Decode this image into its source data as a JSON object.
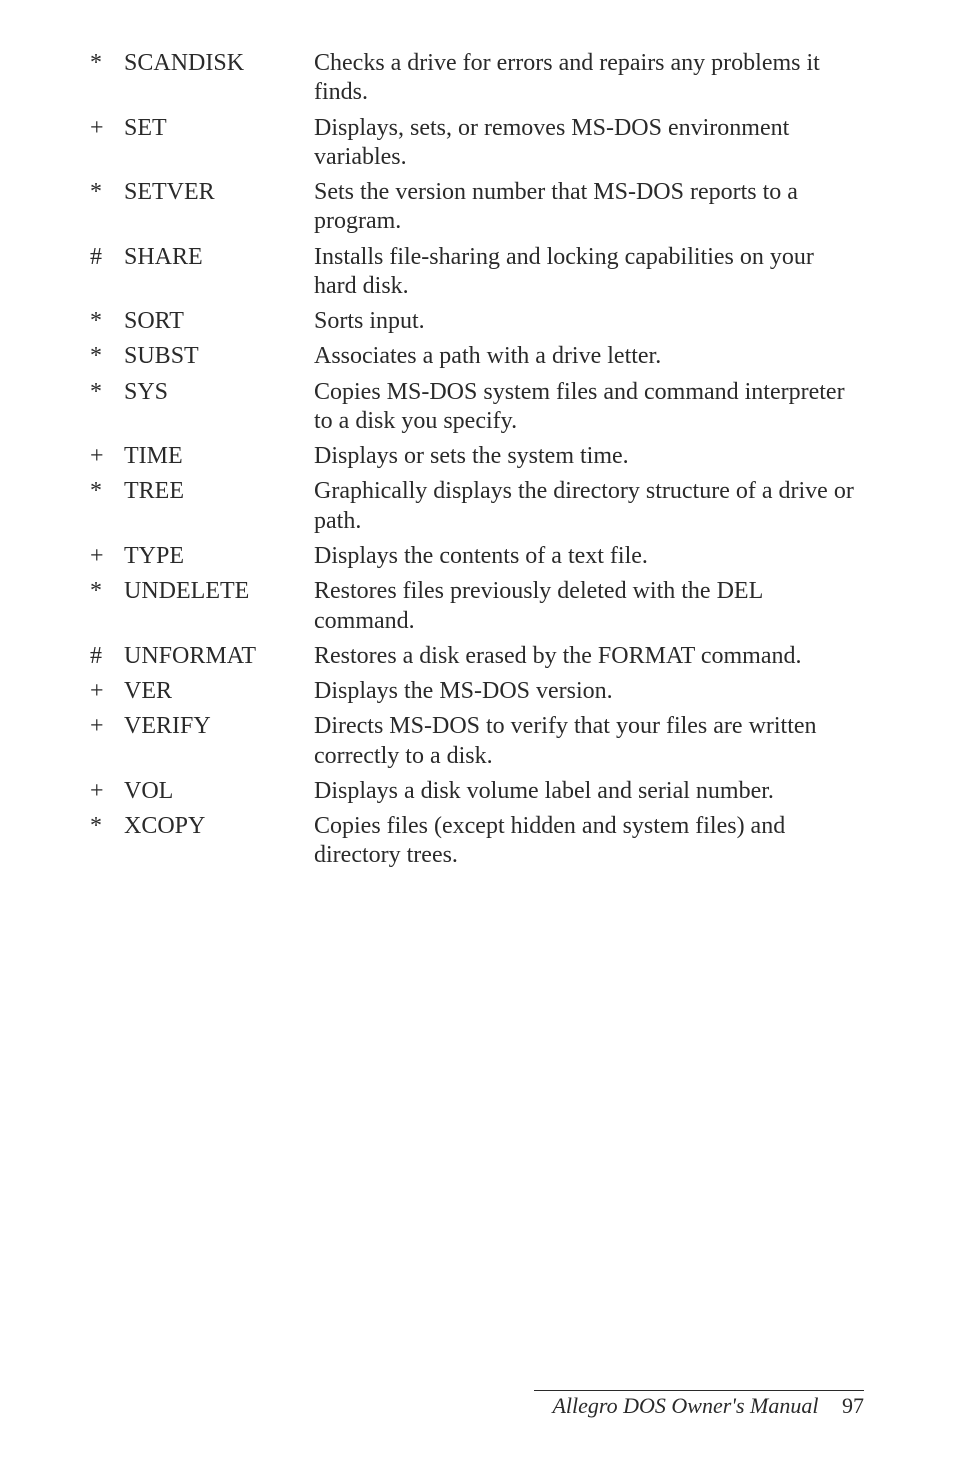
{
  "commands": [
    {
      "marker": "*",
      "name": "SCANDISK",
      "desc": "Checks a drive for errors and repairs any problems it finds."
    },
    {
      "marker": "+",
      "name": "SET",
      "desc": "Displays, sets, or removes MS-DOS environment variables."
    },
    {
      "marker": "*",
      "name": "SETVER",
      "desc": "Sets the version number that MS-DOS reports to a program."
    },
    {
      "marker": "#",
      "name": "SHARE",
      "desc": "Installs file-sharing and locking capabilities on your hard disk."
    },
    {
      "marker": "*",
      "name": "SORT",
      "desc": "Sorts input."
    },
    {
      "marker": "*",
      "name": "SUBST",
      "desc": "Associates a path with a drive letter."
    },
    {
      "marker": "*",
      "name": "SYS",
      "desc": "Copies MS-DOS system files and command interpreter to a disk you specify."
    },
    {
      "marker": "+",
      "name": "TIME",
      "desc": "Displays or sets the system time."
    },
    {
      "marker": "*",
      "name": "TREE",
      "desc": "Graphically displays the directory structure of a drive or path."
    },
    {
      "marker": "+",
      "name": "TYPE",
      "desc": "Displays the contents of a text file."
    },
    {
      "marker": "*",
      "name": "UNDELETE",
      "desc": "Restores files previously deleted with the DEL command."
    },
    {
      "marker": "#",
      "name": "UNFORMAT",
      "desc": "Restores a disk erased by the FORMAT command."
    },
    {
      "marker": "+",
      "name": "VER",
      "desc": "Displays the MS-DOS version."
    },
    {
      "marker": "+",
      "name": "VERIFY",
      "desc": "Directs MS-DOS to verify that your files are written correctly to a disk."
    },
    {
      "marker": "+",
      "name": "VOL",
      "desc": "Displays a disk volume label and serial number."
    },
    {
      "marker": "*",
      "name": "XCOPY",
      "desc": "Copies files (except hidden and system files) and directory trees."
    }
  ],
  "footer": {
    "title": "Allegro DOS Owner's Manual",
    "page": "97"
  }
}
